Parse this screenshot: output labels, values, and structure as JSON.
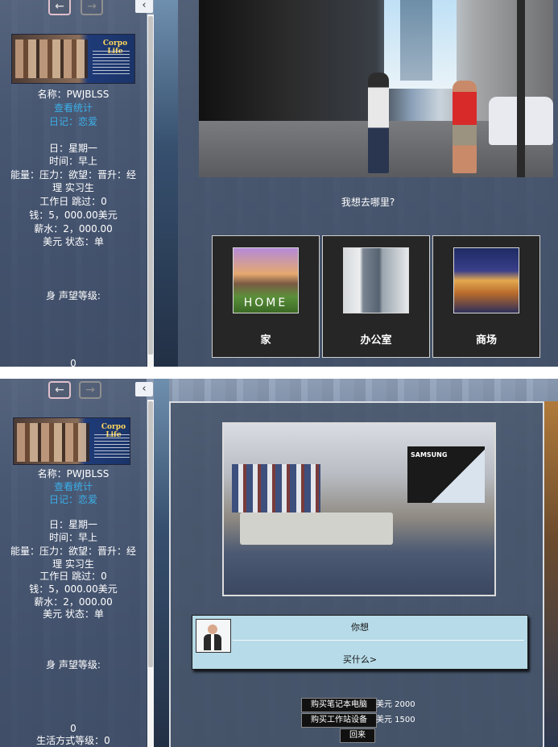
{
  "panels": [
    {
      "sidebar": {
        "banner_title": "Corpo Life",
        "name_line": "名称：PWJBLSS",
        "stats_link": "查看统计",
        "diary_link": "日记：恋爱",
        "day_line": "日：星期一",
        "time_line": "时间：早上",
        "attrs_line1": "能量：压力：欲望：晋升：经",
        "attrs_line2": "理 实习生",
        "workday_line": "工作日 跳过：0",
        "money_line": "钱：5，000.00美元",
        "salary_line": "薪水：2，000.00",
        "currency_status_line": "美元 状态：单",
        "reputation_line": "身 声望等级:",
        "reputation_value": "0"
      },
      "main": {
        "question": "我想去哪里?",
        "destinations": [
          {
            "label": "家",
            "image_text": "HOME"
          },
          {
            "label": "办公室"
          },
          {
            "label": "商场"
          }
        ]
      }
    },
    {
      "sidebar": {
        "banner_title": "Corpo Life",
        "name_line": "名称：PWJBLSS",
        "stats_link": "查看统计",
        "diary_link": "日记：恋爱",
        "day_line": "日：星期一",
        "time_line": "时间：早上",
        "attrs_line1": "能量：压力：欲望：晋升：经",
        "attrs_line2": "理 实习生",
        "workday_line": "工作日 跳过：0",
        "money_line": "钱：5，000.00美元",
        "salary_line": "薪水：2，000.00",
        "currency_status_line": "美元 状态：单",
        "reputation_line": "身 声望等级:",
        "reputation_value": "0",
        "lifestyle_line": "生活方式等级：0"
      },
      "main": {
        "store_sign": "SAMSUNG",
        "dialog_line1": "你想",
        "dialog_line2": "买什么>",
        "buy_laptop": "购买笔记本电脑",
        "laptop_price": "美元 2000",
        "buy_workstation": "购买工作站设备",
        "workstation_price": "美元 1500",
        "back": "回来"
      }
    }
  ],
  "nav": {
    "back_icon": "←",
    "forward_icon": "→",
    "collapse_icon": "‹"
  },
  "colors": {
    "link": "#3ab0ea",
    "sidebar": "#46556e",
    "dialog": "#b7dbe8"
  }
}
